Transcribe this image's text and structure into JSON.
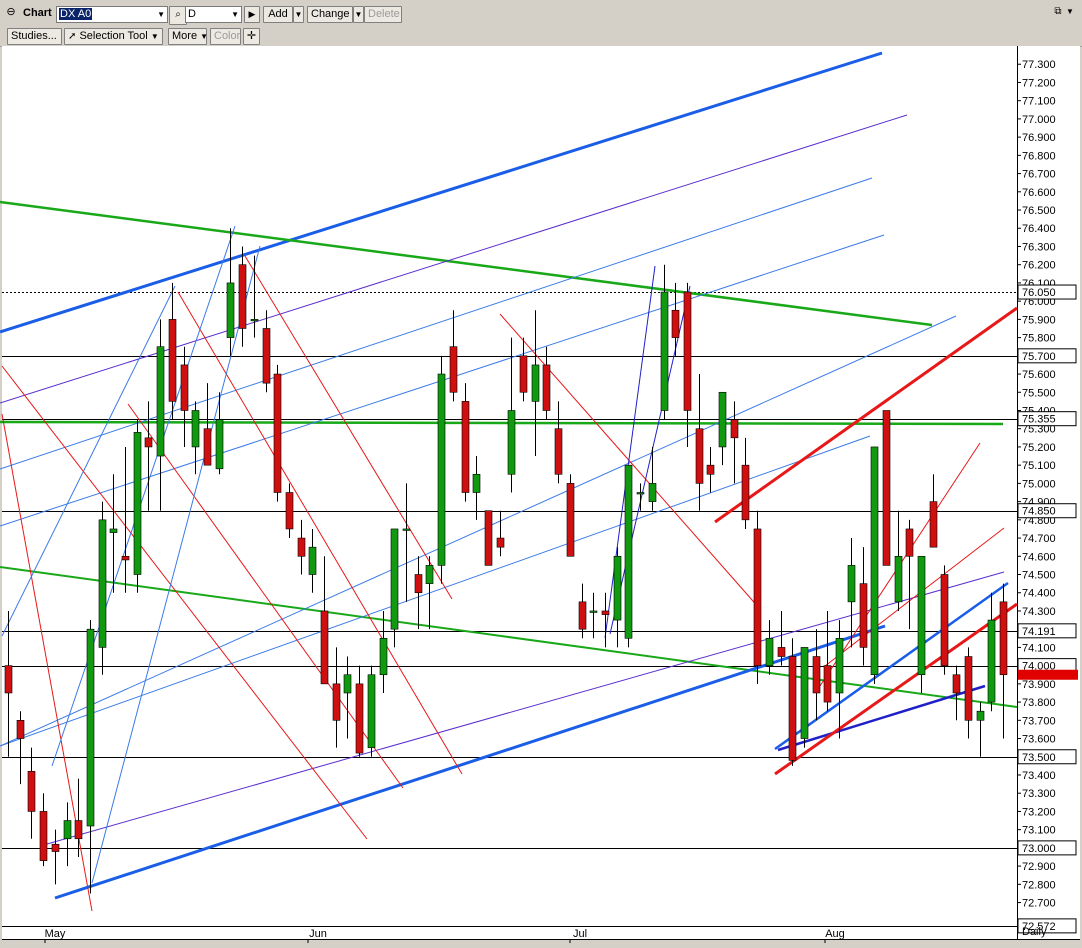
{
  "toolbar": {
    "title": "Chart",
    "symbol": "DX A0",
    "interval": "D",
    "add_label": "Add",
    "change_label": "Change",
    "delete_label": "Delete",
    "studies_label": "Studies...",
    "selection_tool_label": "Selection Tool",
    "more_label": "More",
    "color_label": "Color"
  },
  "chart_data": {
    "type": "candlestick",
    "timeframe": "Daily",
    "x_labels": [
      "May",
      "Jun",
      "Jul",
      "Aug"
    ],
    "y_ticks": [
      72.7,
      72.8,
      72.9,
      73.0,
      73.1,
      73.2,
      73.3,
      73.4,
      73.5,
      73.6,
      73.7,
      73.8,
      73.9,
      74.0,
      74.1,
      74.2,
      74.3,
      74.4,
      74.5,
      74.6,
      74.7,
      74.8,
      74.9,
      75.0,
      75.1,
      75.2,
      75.3,
      75.4,
      75.5,
      75.6,
      75.7,
      75.8,
      75.9,
      76.0,
      76.1,
      76.2,
      76.3,
      76.4,
      76.5,
      76.6,
      76.7,
      76.8,
      76.9,
      77.0,
      77.1,
      77.2,
      77.3
    ],
    "y_range": [
      72.5,
      77.4
    ],
    "horizontal_levels": [
      {
        "value": 76.05,
        "label": "76.050",
        "style": "dashed"
      },
      {
        "value": 75.7,
        "label": "75.700"
      },
      {
        "value": 75.355,
        "label": "75.355"
      },
      {
        "value": 74.85,
        "label": "74.850"
      },
      {
        "value": 74.191,
        "label": "74.191"
      },
      {
        "value": 74.0,
        "label": "74.000"
      },
      {
        "value": 73.5,
        "label": "73.500"
      },
      {
        "value": 73.0,
        "label": "73.000"
      },
      {
        "value": 72.572,
        "label": "72.572"
      }
    ],
    "current_price": {
      "value": 73.95,
      "color": "#e00000"
    },
    "colors": {
      "up": "#0f9a0f",
      "down": "#d01010",
      "background": "#ffffff"
    },
    "candles": [
      {
        "o": 74.0,
        "h": 74.3,
        "l": 73.5,
        "c": 73.85
      },
      {
        "o": 73.7,
        "h": 73.75,
        "l": 73.35,
        "c": 73.6
      },
      {
        "o": 73.42,
        "h": 73.55,
        "l": 73.05,
        "c": 73.2
      },
      {
        "o": 73.2,
        "h": 73.3,
        "l": 72.9,
        "c": 72.93
      },
      {
        "o": 73.02,
        "h": 73.1,
        "l": 72.8,
        "c": 72.98
      },
      {
        "o": 73.05,
        "h": 73.25,
        "l": 72.9,
        "c": 73.15
      },
      {
        "o": 73.15,
        "h": 73.38,
        "l": 72.95,
        "c": 73.05
      },
      {
        "o": 73.12,
        "h": 74.25,
        "l": 72.75,
        "c": 74.2
      },
      {
        "o": 74.1,
        "h": 74.9,
        "l": 73.95,
        "c": 74.8
      },
      {
        "o": 74.73,
        "h": 75.05,
        "l": 74.4,
        "c": 74.75
      },
      {
        "o": 74.6,
        "h": 75.2,
        "l": 74.4,
        "c": 74.58
      },
      {
        "o": 74.5,
        "h": 75.35,
        "l": 74.4,
        "c": 75.28
      },
      {
        "o": 75.25,
        "h": 75.45,
        "l": 74.85,
        "c": 75.2
      },
      {
        "o": 75.15,
        "h": 75.9,
        "l": 74.85,
        "c": 75.75
      },
      {
        "o": 75.9,
        "h": 76.1,
        "l": 75.35,
        "c": 75.45
      },
      {
        "o": 75.65,
        "h": 75.75,
        "l": 75.2,
        "c": 75.4
      },
      {
        "o": 75.2,
        "h": 75.45,
        "l": 75.05,
        "c": 75.4
      },
      {
        "o": 75.3,
        "h": 75.55,
        "l": 75.1,
        "c": 75.1
      },
      {
        "o": 75.08,
        "h": 75.5,
        "l": 75.05,
        "c": 75.35
      },
      {
        "o": 75.8,
        "h": 76.4,
        "l": 75.7,
        "c": 76.1
      },
      {
        "o": 76.2,
        "h": 76.3,
        "l": 75.75,
        "c": 75.85
      },
      {
        "o": 75.9,
        "h": 76.25,
        "l": 75.8,
        "c": 75.9
      },
      {
        "o": 75.85,
        "h": 75.95,
        "l": 75.5,
        "c": 75.55
      },
      {
        "o": 75.6,
        "h": 75.65,
        "l": 74.9,
        "c": 74.95
      },
      {
        "o": 74.95,
        "h": 75.0,
        "l": 74.7,
        "c": 74.75
      },
      {
        "o": 74.7,
        "h": 74.8,
        "l": 74.5,
        "c": 74.6
      },
      {
        "o": 74.5,
        "h": 74.75,
        "l": 74.4,
        "c": 74.65
      },
      {
        "o": 74.3,
        "h": 74.6,
        "l": 73.9,
        "c": 73.9
      },
      {
        "o": 73.9,
        "h": 74.1,
        "l": 73.55,
        "c": 73.7
      },
      {
        "o": 73.85,
        "h": 74.05,
        "l": 73.6,
        "c": 73.95
      },
      {
        "o": 73.9,
        "h": 74.0,
        "l": 73.5,
        "c": 73.52
      },
      {
        "o": 73.55,
        "h": 74.0,
        "l": 73.5,
        "c": 73.95
      },
      {
        "o": 73.95,
        "h": 74.3,
        "l": 73.85,
        "c": 74.15
      },
      {
        "o": 74.2,
        "h": 74.75,
        "l": 74.1,
        "c": 74.75
      },
      {
        "o": 74.75,
        "h": 75.0,
        "l": 74.35,
        "c": 74.75
      },
      {
        "o": 74.5,
        "h": 74.6,
        "l": 74.2,
        "c": 74.4
      },
      {
        "o": 74.45,
        "h": 74.6,
        "l": 74.2,
        "c": 74.55
      },
      {
        "o": 74.55,
        "h": 75.7,
        "l": 74.45,
        "c": 75.6
      },
      {
        "o": 75.75,
        "h": 75.95,
        "l": 75.45,
        "c": 75.5
      },
      {
        "o": 75.45,
        "h": 75.55,
        "l": 74.9,
        "c": 74.95
      },
      {
        "o": 74.95,
        "h": 75.15,
        "l": 74.8,
        "c": 75.05
      },
      {
        "o": 74.85,
        "h": 74.85,
        "l": 74.55,
        "c": 74.55
      },
      {
        "o": 74.7,
        "h": 74.85,
        "l": 74.6,
        "c": 74.65
      },
      {
        "o": 75.05,
        "h": 75.8,
        "l": 74.95,
        "c": 75.4
      },
      {
        "o": 75.7,
        "h": 75.8,
        "l": 75.45,
        "c": 75.5
      },
      {
        "o": 75.45,
        "h": 75.95,
        "l": 75.15,
        "c": 75.65
      },
      {
        "o": 75.65,
        "h": 75.75,
        "l": 75.35,
        "c": 75.4
      },
      {
        "o": 75.3,
        "h": 75.45,
        "l": 75.0,
        "c": 75.05
      },
      {
        "o": 75.0,
        "h": 75.05,
        "l": 74.6,
        "c": 74.6
      },
      {
        "o": 74.35,
        "h": 74.45,
        "l": 74.15,
        "c": 74.2
      },
      {
        "o": 74.3,
        "h": 74.4,
        "l": 74.15,
        "c": 74.3
      },
      {
        "o": 74.3,
        "h": 74.4,
        "l": 74.1,
        "c": 74.28
      },
      {
        "o": 74.25,
        "h": 74.65,
        "l": 74.1,
        "c": 74.6
      },
      {
        "o": 74.15,
        "h": 75.1,
        "l": 74.1,
        "c": 75.1
      },
      {
        "o": 74.95,
        "h": 75.0,
        "l": 74.85,
        "c": 74.95
      },
      {
        "o": 74.9,
        "h": 75.2,
        "l": 74.85,
        "c": 75.0
      },
      {
        "o": 75.4,
        "h": 76.2,
        "l": 75.35,
        "c": 76.05
      },
      {
        "o": 75.95,
        "h": 76.1,
        "l": 75.7,
        "c": 75.8
      },
      {
        "o": 76.05,
        "h": 76.1,
        "l": 75.2,
        "c": 75.4
      },
      {
        "o": 75.3,
        "h": 75.6,
        "l": 74.85,
        "c": 75.0
      },
      {
        "o": 75.1,
        "h": 75.2,
        "l": 74.95,
        "c": 75.05
      },
      {
        "o": 75.2,
        "h": 75.5,
        "l": 75.1,
        "c": 75.5
      },
      {
        "o": 75.35,
        "h": 75.45,
        "l": 75.0,
        "c": 75.25
      },
      {
        "o": 75.1,
        "h": 75.25,
        "l": 74.75,
        "c": 74.8
      },
      {
        "o": 74.75,
        "h": 74.85,
        "l": 73.9,
        "c": 74.0
      },
      {
        "o": 74.0,
        "h": 74.25,
        "l": 73.95,
        "c": 74.15
      },
      {
        "o": 74.1,
        "h": 74.3,
        "l": 74.0,
        "c": 74.05
      },
      {
        "o": 74.05,
        "h": 74.15,
        "l": 73.45,
        "c": 73.48
      },
      {
        "o": 73.6,
        "h": 74.1,
        "l": 73.55,
        "c": 74.1
      },
      {
        "o": 74.05,
        "h": 74.2,
        "l": 73.7,
        "c": 73.85
      },
      {
        "o": 74.0,
        "h": 74.3,
        "l": 73.75,
        "c": 73.8
      },
      {
        "o": 73.85,
        "h": 74.25,
        "l": 73.6,
        "c": 74.15
      },
      {
        "o": 74.35,
        "h": 74.7,
        "l": 74.1,
        "c": 74.55
      },
      {
        "o": 74.45,
        "h": 74.65,
        "l": 74.0,
        "c": 74.1
      },
      {
        "o": 73.95,
        "h": 74.35,
        "l": 73.9,
        "c": 75.2
      },
      {
        "o": 75.4,
        "h": 75.4,
        "l": 74.55,
        "c": 74.55
      },
      {
        "o": 74.35,
        "h": 74.85,
        "l": 74.3,
        "c": 74.6
      },
      {
        "o": 74.75,
        "h": 74.8,
        "l": 74.2,
        "c": 74.6
      },
      {
        "o": 73.95,
        "h": 74.6,
        "l": 73.85,
        "c": 74.6
      },
      {
        "o": 74.9,
        "h": 75.05,
        "l": 74.65,
        "c": 74.65
      },
      {
        "o": 74.5,
        "h": 74.55,
        "l": 73.95,
        "c": 74.0
      },
      {
        "o": 73.95,
        "h": 74.0,
        "l": 73.7,
        "c": 73.85
      },
      {
        "o": 74.05,
        "h": 74.1,
        "l": 73.6,
        "c": 73.7
      },
      {
        "o": 73.7,
        "h": 73.8,
        "l": 73.5,
        "c": 73.75
      },
      {
        "o": 73.8,
        "h": 74.4,
        "l": 73.75,
        "c": 74.25
      },
      {
        "o": 74.35,
        "h": 74.45,
        "l": 73.6,
        "c": 73.95
      }
    ]
  }
}
